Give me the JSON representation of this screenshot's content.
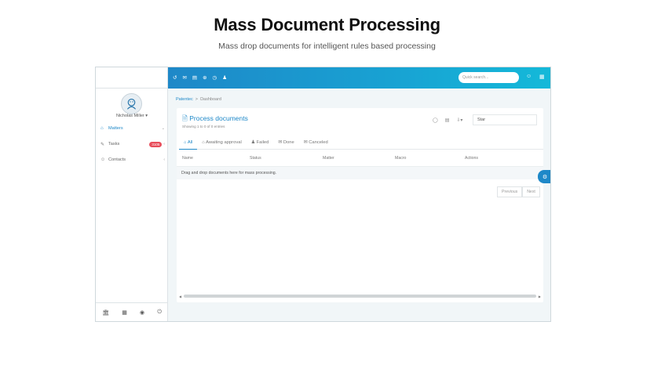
{
  "hero": {
    "title": "Mass Document Processing",
    "subtitle": "Mass drop documents for intelligent rules based processing"
  },
  "sidebar": {
    "user_name": "Nicholas Miller ▾",
    "items": [
      {
        "label": "Matters",
        "icon": "home-icon",
        "active": true
      },
      {
        "label": "Tasks",
        "icon": "pencil-icon",
        "badge": "3105"
      },
      {
        "label": "Contacts",
        "icon": "users-icon"
      }
    ],
    "footer_icons": [
      "bank-icon",
      "grid-icon",
      "support-icon",
      "power-icon"
    ]
  },
  "topbar": {
    "search_placeholder": "Quick search...",
    "icons": [
      "arrow-circle-icon",
      "mail-icon",
      "calendar-icon",
      "plus-circle-icon",
      "clock-icon",
      "user-icon"
    ]
  },
  "breadcrumb": {
    "home": "Patentec",
    "separator": ">",
    "current": "Dashboard"
  },
  "card": {
    "title": "Process documents",
    "subtitle": "Showing 1 to 0 of 0 entries",
    "filter_value": "Star",
    "tabs": [
      "All",
      "Awaiting approval",
      "Failed",
      "Done",
      "Canceled"
    ],
    "columns": [
      "Name",
      "Status",
      "Matter",
      "Macro",
      "Actions"
    ],
    "empty_message": "Drag and drop documents here for mass processing.",
    "pager": {
      "previous": "Previous",
      "next": "Next"
    }
  },
  "colors": {
    "accent": "#1e88c8",
    "topbar_end": "#14b9d9",
    "badge": "#e84d5b"
  }
}
